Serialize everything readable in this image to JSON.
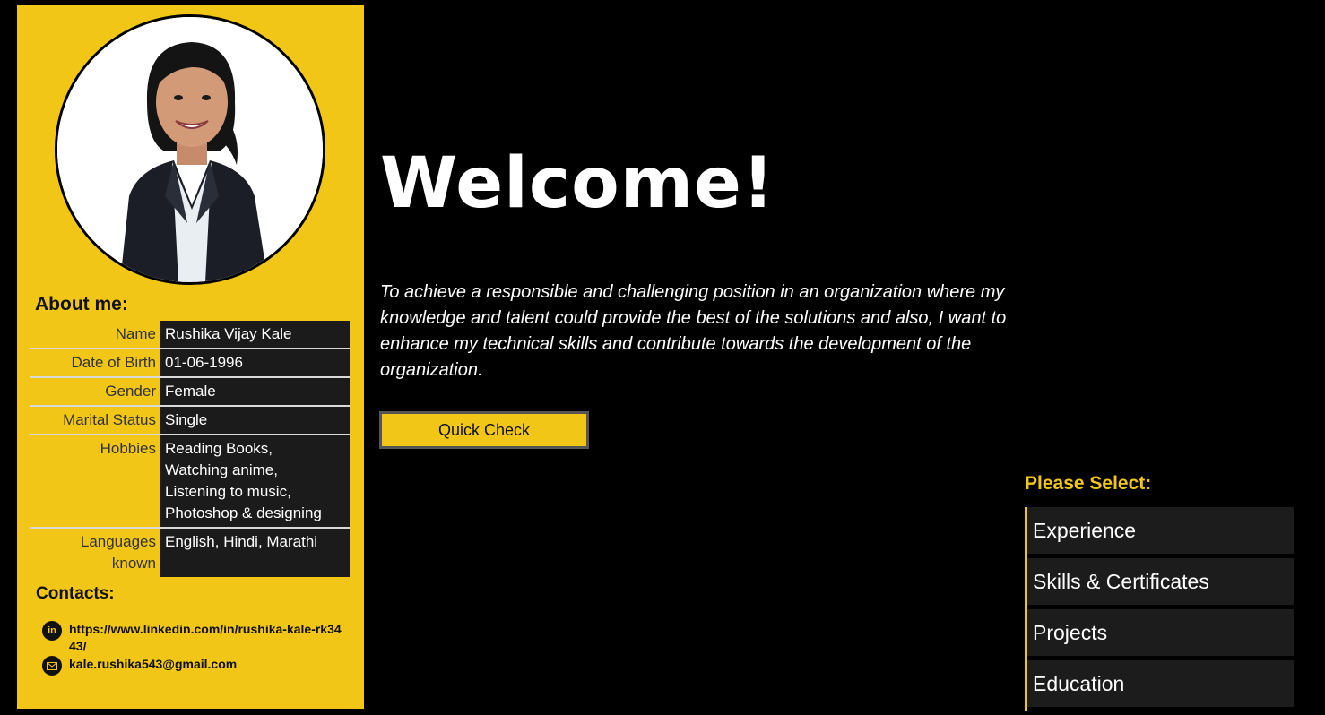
{
  "sidebar": {
    "about_title": "About me:",
    "about": [
      {
        "key": "Name",
        "value": "Rushika Vijay Kale"
      },
      {
        "key": "Date of Birth",
        "value": "01-06-1996"
      },
      {
        "key": "Gender",
        "value": "Female"
      },
      {
        "key": "Marital Status",
        "value": "Single"
      },
      {
        "key": "Hobbies",
        "value": "Reading Books,\nWatching anime,\nListening to music,\nPhotoshop & designing"
      },
      {
        "key": "Languages known",
        "value": "English, Hindi, Marathi"
      }
    ],
    "contacts_title": "Contacts:",
    "contacts": {
      "linkedin": "https://www.linkedin.com/in/rushika-kale-rk3443/",
      "email": "kale.rushika543@gmail.com"
    }
  },
  "main": {
    "welcome": "Welcome!",
    "objective": "To achieve a responsible and challenging position in an organization where my knowledge and talent could provide the best of the solutions and also, I want to enhance my technical skills and contribute towards the development of the organization.",
    "quick_check_label": "Quick Check"
  },
  "menu": {
    "title": "Please Select:",
    "items": [
      {
        "label": "Experience"
      },
      {
        "label": "Skills & Certificates"
      },
      {
        "label": "Projects"
      },
      {
        "label": "Education"
      }
    ]
  },
  "colors": {
    "accent": "#f1c617",
    "background": "#000000",
    "panel": "#1b1b1b"
  },
  "icons": {
    "linkedin": "linkedin-icon",
    "email": "envelope-icon"
  }
}
